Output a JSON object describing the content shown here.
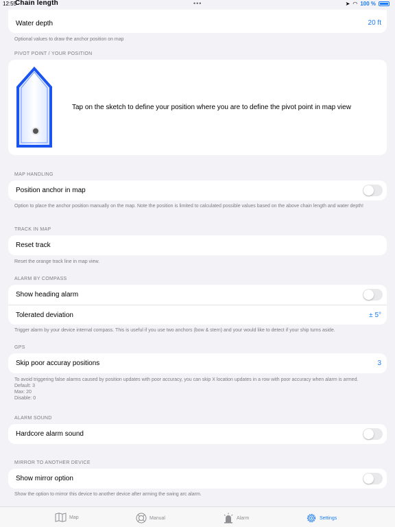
{
  "status": {
    "time": "12:55",
    "app_title": "Chain length",
    "dots": "•••",
    "battery_text": "100 %"
  },
  "rows": {
    "water_depth": {
      "label": "Water depth",
      "value": "20 ft"
    },
    "position_anchor": {
      "label": "Position anchor in map"
    },
    "reset_track": {
      "label": "Reset track"
    },
    "show_heading": {
      "label": "Show heading alarm"
    },
    "tolerated_deviation": {
      "label": "Tolerated deviation",
      "value": "± 5°"
    },
    "skip_poor": {
      "label": "Skip poor accuray positions",
      "value": "3"
    },
    "hardcore_sound": {
      "label": "Hardcore alarm sound"
    },
    "show_mirror": {
      "label": "Show mirror option"
    }
  },
  "sections": {
    "pivot": "PIVOT POINT / YOUR POSITION",
    "map_handling": "MAP HANDLING",
    "track_in_map": "TRACK IN MAP",
    "alarm_by_compass": "ALARM BY COMPASS",
    "gps": "GPS",
    "alarm_sound": "ALARM SOUND",
    "mirror": "MIRROR TO ANOTHER DEVICE"
  },
  "footnotes": {
    "water_depth": "Optional values to draw the anchor position on map",
    "map_handling": "Option to place the anchor position manually on the map. Note the position is limited to calculated possible values based on the above chain length and water depth!",
    "track": "Reset the orange track line in map view.",
    "compass": "Trigger alarm by your device internal compass. This is useful if you use two anchors (bow & stern) and your would like to detect if your ship turns aside.",
    "gps_1": "To avoid triggering false alarms caused by position updates with poor accuracy, you can skip X location updates in a row with poor accuracy when alarm is armed.",
    "gps_2": "Default: 3",
    "gps_3": "Max: 20",
    "gps_4": "Disable: 0",
    "mirror": "Show the option to mirror this device to another device after arming the swing arc alarm."
  },
  "pivot": {
    "instruction": "Tap on the sketch to define your position where you are to define the pivot point in map view"
  },
  "tabs": [
    {
      "label": "Map",
      "icon": "map-icon"
    },
    {
      "label": "Manual",
      "icon": "lifebuoy-icon"
    },
    {
      "label": "Alarm",
      "icon": "alarm-light-icon"
    },
    {
      "label": "Settings",
      "icon": "gear-icon"
    }
  ],
  "colors": {
    "accent": "#1a7cf5",
    "background": "#f2f2f7",
    "secondary_text": "#7b7b80"
  }
}
